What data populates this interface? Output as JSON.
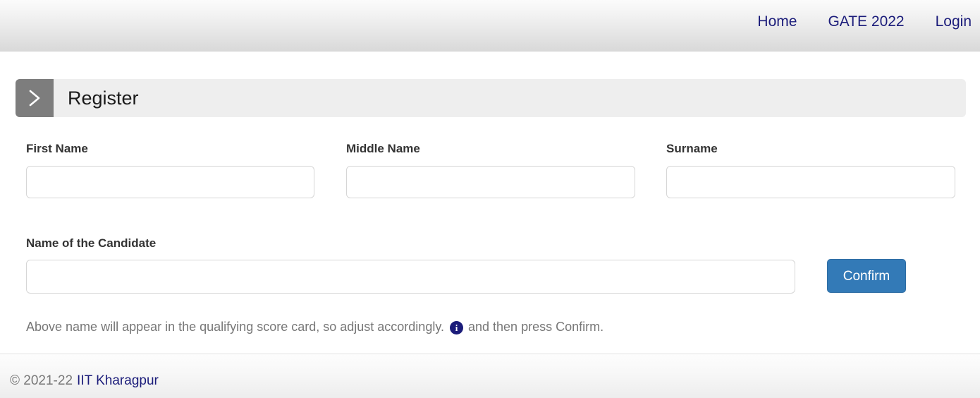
{
  "nav": {
    "items": [
      {
        "label": "Home",
        "name": "nav-link-home"
      },
      {
        "label": "GATE 2022",
        "name": "nav-link-gate-2022"
      },
      {
        "label": "Login",
        "name": "nav-link-login"
      }
    ]
  },
  "panel": {
    "title": "Register",
    "chevron_icon": "chevron-right-icon",
    "badge_color": "#7d7d7d",
    "background_color": "#eeeeee"
  },
  "form": {
    "first_name": {
      "label": "First Name",
      "value": "",
      "placeholder": ""
    },
    "middle_name": {
      "label": "Middle Name",
      "value": "",
      "placeholder": ""
    },
    "surname": {
      "label": "Surname",
      "value": "",
      "placeholder": ""
    },
    "candidate_name": {
      "label": "Name of the Candidate",
      "value": "",
      "placeholder": ""
    },
    "confirm_button": {
      "label": "Confirm",
      "color": "#337ab7"
    },
    "help": {
      "text_before": "Above name will appear in the qualifying score card, so adjust accordingly.",
      "info_icon": "info-circle-icon",
      "info_icon_color": "#1b1c7a",
      "text_after": "and then press Confirm."
    }
  },
  "footer": {
    "copyright": "© 2021-22",
    "link_label": "IIT Kharagpur",
    "link_color": "#1b1c7a"
  },
  "theme": {
    "link_color": "#1b1c7a",
    "muted_text": "#777777",
    "label_text": "#333333"
  }
}
